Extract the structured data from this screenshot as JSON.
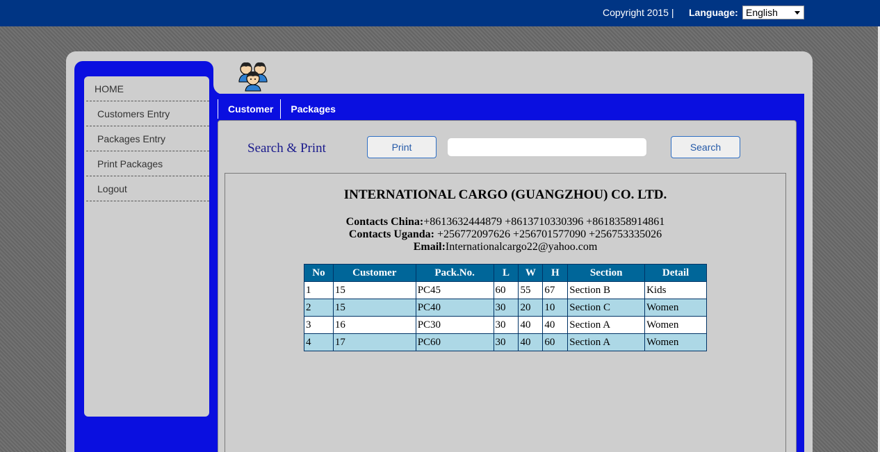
{
  "header": {
    "copyright": "Copyright 2015 |",
    "language_label": "Language:",
    "language_selected": "English"
  },
  "sidebar": {
    "items": [
      {
        "label": "HOME"
      },
      {
        "label": "Customers Entry"
      },
      {
        "label": "Packages Entry"
      },
      {
        "label": "Print Packages"
      },
      {
        "label": "Logout"
      }
    ]
  },
  "logo": {
    "icon": "users-group-icon"
  },
  "tabs": [
    {
      "label": "Customer"
    },
    {
      "label": "Packages"
    }
  ],
  "toolbar": {
    "title": "Search & Print",
    "print_label": "Print",
    "search_label": "Search",
    "search_value": ""
  },
  "report": {
    "company": "INTERNATIONAL CARGO (GUANGZHOU) CO. LTD.",
    "china_label": "Contacts China:",
    "china_value": "+8613632444879 +8613710330396 +8618358914861",
    "uganda_label": "Contacts Uganda:",
    "uganda_value": " +256772097626 +256701577090 +256753335026",
    "email_label": "Email:",
    "email_value": "Internationalcargo22@yahoo.com",
    "columns": [
      "No",
      "Customer",
      "Pack.No.",
      "L",
      "W",
      "H",
      "Section",
      "Detail"
    ],
    "rows": [
      [
        "1",
        "15",
        "PC45",
        "60",
        "55",
        "67",
        "Section B",
        "Kids"
      ],
      [
        "2",
        "15",
        "PC40",
        "30",
        "20",
        "10",
        "Section C",
        "Women"
      ],
      [
        "3",
        "16",
        "PC30",
        "30",
        "40",
        "40",
        "Section A",
        "Women"
      ],
      [
        "4",
        "17",
        "PC60",
        "30",
        "40",
        "60",
        "Section A",
        "Women"
      ]
    ]
  },
  "colors": {
    "topbar": "#003584",
    "panel_blue": "#0a0fe0",
    "table_header": "#006699",
    "row_alt": "#add8e6"
  }
}
